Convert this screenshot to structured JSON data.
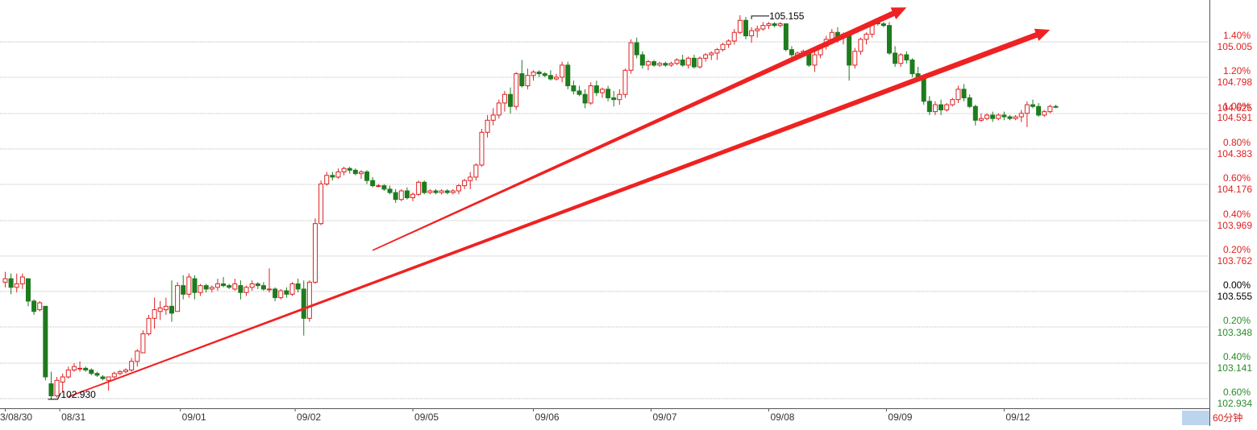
{
  "chart_data": {
    "type": "candlestick",
    "period": "60分钟",
    "colors": {
      "up": "#dd2222",
      "down": "#1e7b1e",
      "grid": "#bbbbbb",
      "axis": "#555555",
      "pct_up": "#dd2222",
      "pct_down": "#2a8c2a",
      "trendline": "#ee2222",
      "period_bg": "#bcd4ee"
    },
    "price_axis": {
      "min": 102.934,
      "max": 105.212,
      "ticks": [
        "105.005",
        "104.798",
        "104.591",
        "104.383",
        "104.176",
        "103.969",
        "103.762",
        "103.555",
        "103.348",
        "103.141",
        "102.934"
      ],
      "last_price": "104.625"
    },
    "pct_axis": {
      "reference_price": 103.555,
      "ticks": [
        "1.40%",
        "1.20%",
        "1.00%",
        "0.80%",
        "0.60%",
        "0.40%",
        "0.20%",
        "0.00%",
        "0.20%",
        "0.40%",
        "0.60%"
      ]
    },
    "dates": [
      "3/08/30",
      "08/31",
      "09/01",
      "09/02",
      "09/05",
      "09/06",
      "09/07",
      "09/08",
      "09/09",
      "09/12"
    ],
    "date_slot_index": [
      0,
      9.5,
      30.5,
      50.5,
      71,
      92,
      112.5,
      133,
      153.5,
      174
    ],
    "annotations": [
      {
        "label": "105.155",
        "price": 105.155,
        "bar_index": 130
      },
      {
        "label": "102.930",
        "price": 102.93,
        "bar_index": 8
      }
    ],
    "trendlines": [
      {
        "from_bar": 11,
        "from_price": 102.945,
        "to_bar": 182,
        "to_price": 105.075
      },
      {
        "from_bar": 64,
        "from_price": 103.795,
        "to_bar": 157,
        "to_price": 105.205
      }
    ],
    "candles": [
      [
        103.61,
        103.67,
        103.58,
        103.63
      ],
      [
        103.63,
        103.66,
        103.54,
        103.58
      ],
      [
        103.58,
        103.66,
        103.55,
        103.6
      ],
      [
        103.6,
        103.66,
        103.57,
        103.64
      ],
      [
        103.63,
        103.63,
        103.47,
        103.5
      ],
      [
        103.5,
        103.51,
        103.42,
        103.44
      ],
      [
        103.45,
        103.5,
        103.44,
        103.49
      ],
      [
        103.47,
        103.47,
        103.04,
        103.06
      ],
      [
        103.02,
        103.09,
        102.93,
        102.95
      ],
      [
        102.95,
        103.06,
        102.94,
        103.04
      ],
      [
        103.03,
        103.08,
        102.97,
        103.06
      ],
      [
        103.06,
        103.12,
        103.05,
        103.1
      ],
      [
        103.1,
        103.14,
        103.09,
        103.12
      ],
      [
        103.11,
        103.15,
        103.09,
        103.11
      ],
      [
        103.11,
        103.12,
        103.09,
        103.1
      ],
      [
        103.1,
        103.11,
        103.07,
        103.08
      ],
      [
        103.08,
        103.09,
        103.06,
        103.07
      ],
      [
        103.06,
        103.07,
        103.04,
        103.05
      ],
      [
        103.04,
        103.05,
        102.98,
        103.06
      ],
      [
        103.06,
        103.09,
        103.05,
        103.08
      ],
      [
        103.08,
        103.1,
        103.07,
        103.09
      ],
      [
        103.09,
        103.11,
        103.08,
        103.1
      ],
      [
        103.1,
        103.17,
        103.09,
        103.15
      ],
      [
        103.15,
        103.22,
        103.12,
        103.21
      ],
      [
        103.2,
        103.33,
        103.2,
        103.31
      ],
      [
        103.31,
        103.42,
        103.3,
        103.4
      ],
      [
        103.4,
        103.52,
        103.34,
        103.45
      ],
      [
        103.44,
        103.5,
        103.39,
        103.46
      ],
      [
        103.45,
        103.52,
        103.42,
        103.47
      ],
      [
        103.47,
        103.62,
        103.38,
        103.43
      ],
      [
        103.44,
        103.61,
        103.44,
        103.59
      ],
      [
        103.59,
        103.65,
        103.51,
        103.54
      ],
      [
        103.54,
        103.66,
        103.52,
        103.64
      ],
      [
        103.63,
        103.65,
        103.51,
        103.55
      ],
      [
        103.55,
        103.6,
        103.53,
        103.59
      ],
      [
        103.59,
        103.6,
        103.55,
        103.57
      ],
      [
        103.57,
        103.59,
        103.55,
        103.58
      ],
      [
        103.58,
        103.63,
        103.56,
        103.6
      ],
      [
        103.6,
        103.64,
        103.58,
        103.59
      ],
      [
        103.59,
        103.6,
        103.57,
        103.58
      ],
      [
        103.57,
        103.63,
        103.56,
        103.6
      ],
      [
        103.59,
        103.62,
        103.51,
        103.55
      ],
      [
        103.55,
        103.59,
        103.53,
        103.58
      ],
      [
        103.58,
        103.62,
        103.56,
        103.6
      ],
      [
        103.6,
        103.61,
        103.57,
        103.59
      ],
      [
        103.59,
        103.61,
        103.56,
        103.57
      ],
      [
        103.57,
        103.69,
        103.55,
        103.57
      ],
      [
        103.57,
        103.58,
        103.5,
        103.52
      ],
      [
        103.52,
        103.57,
        103.51,
        103.56
      ],
      [
        103.56,
        103.58,
        103.52,
        103.54
      ],
      [
        103.54,
        103.61,
        103.53,
        103.6
      ],
      [
        103.6,
        103.63,
        103.55,
        103.57
      ],
      [
        103.57,
        103.62,
        103.3,
        103.4
      ],
      [
        103.4,
        103.62,
        103.38,
        103.61
      ],
      [
        103.61,
        103.98,
        103.6,
        103.95
      ],
      [
        103.95,
        104.2,
        103.94,
        104.18
      ],
      [
        104.18,
        104.25,
        104.17,
        104.23
      ],
      [
        104.23,
        104.25,
        104.2,
        104.22
      ],
      [
        104.22,
        104.27,
        104.21,
        104.25
      ],
      [
        104.25,
        104.28,
        104.23,
        104.27
      ],
      [
        104.27,
        104.28,
        104.24,
        104.26
      ],
      [
        104.26,
        104.27,
        104.23,
        104.24
      ],
      [
        104.24,
        104.26,
        104.21,
        104.25
      ],
      [
        104.25,
        104.26,
        104.18,
        104.2
      ],
      [
        104.2,
        104.22,
        104.16,
        104.17
      ],
      [
        104.17,
        104.18,
        104.16,
        104.17
      ],
      [
        104.17,
        104.18,
        104.14,
        104.15
      ],
      [
        104.15,
        104.17,
        104.12,
        104.13
      ],
      [
        104.13,
        104.15,
        104.07,
        104.09
      ],
      [
        104.09,
        104.15,
        104.08,
        104.14
      ],
      [
        104.14,
        104.16,
        104.09,
        104.1
      ],
      [
        104.1,
        104.13,
        104.08,
        104.12
      ],
      [
        104.12,
        104.2,
        104.11,
        104.19
      ],
      [
        104.19,
        104.2,
        104.12,
        104.13
      ],
      [
        104.13,
        104.15,
        104.12,
        104.14
      ],
      [
        104.14,
        104.15,
        104.12,
        104.13
      ],
      [
        104.13,
        104.15,
        104.12,
        104.14
      ],
      [
        104.14,
        104.15,
        104.12,
        104.13
      ],
      [
        104.13,
        104.15,
        104.12,
        104.14
      ],
      [
        104.14,
        104.18,
        104.12,
        104.17
      ],
      [
        104.17,
        104.21,
        104.15,
        104.2
      ],
      [
        104.2,
        104.25,
        104.15,
        104.22
      ],
      [
        104.22,
        104.3,
        104.2,
        104.29
      ],
      [
        104.29,
        104.5,
        104.28,
        104.48
      ],
      [
        104.48,
        104.58,
        104.45,
        104.55
      ],
      [
        104.55,
        104.62,
        104.52,
        104.58
      ],
      [
        104.58,
        104.67,
        104.56,
        104.65
      ],
      [
        104.65,
        104.72,
        104.6,
        104.7
      ],
      [
        104.7,
        104.74,
        104.59,
        104.63
      ],
      [
        104.63,
        104.83,
        104.61,
        104.82
      ],
      [
        104.82,
        104.9,
        104.74,
        104.75
      ],
      [
        104.75,
        104.85,
        104.73,
        104.81
      ],
      [
        104.81,
        104.84,
        104.78,
        104.83
      ],
      [
        104.83,
        104.84,
        104.8,
        104.82
      ],
      [
        104.82,
        104.83,
        104.8,
        104.81
      ],
      [
        104.81,
        104.84,
        104.78,
        104.79
      ],
      [
        104.79,
        104.82,
        104.78,
        104.8
      ],
      [
        104.8,
        104.89,
        104.77,
        104.87
      ],
      [
        104.87,
        104.89,
        104.73,
        104.75
      ],
      [
        104.75,
        104.78,
        104.7,
        104.72
      ],
      [
        104.72,
        104.75,
        104.69,
        104.7
      ],
      [
        104.7,
        104.73,
        104.62,
        104.65
      ],
      [
        104.65,
        104.77,
        104.64,
        104.75
      ],
      [
        104.75,
        104.78,
        104.69,
        104.71
      ],
      [
        104.71,
        104.74,
        104.68,
        104.73
      ],
      [
        104.73,
        104.75,
        104.66,
        104.68
      ],
      [
        104.68,
        104.72,
        104.63,
        104.67
      ],
      [
        104.67,
        104.73,
        104.64,
        104.7
      ],
      [
        104.7,
        104.85,
        104.68,
        104.84
      ],
      [
        104.84,
        105.02,
        104.82,
        105.0
      ],
      [
        105.0,
        105.03,
        104.91,
        104.93
      ],
      [
        104.93,
        104.95,
        104.85,
        104.87
      ],
      [
        104.87,
        104.9,
        104.84,
        104.89
      ],
      [
        104.89,
        104.9,
        104.86,
        104.87
      ],
      [
        104.87,
        104.89,
        104.86,
        104.88
      ],
      [
        104.88,
        104.89,
        104.86,
        104.87
      ],
      [
        104.87,
        104.89,
        104.86,
        104.88
      ],
      [
        104.88,
        104.91,
        104.87,
        104.9
      ],
      [
        104.9,
        104.93,
        104.86,
        104.87
      ],
      [
        104.87,
        104.92,
        104.85,
        104.91
      ],
      [
        104.91,
        104.93,
        104.85,
        104.86
      ],
      [
        104.86,
        104.92,
        104.85,
        104.91
      ],
      [
        104.91,
        104.94,
        104.89,
        104.93
      ],
      [
        104.93,
        104.95,
        104.9,
        104.94
      ],
      [
        104.94,
        104.97,
        104.9,
        104.96
      ],
      [
        104.96,
        105.0,
        104.95,
        104.99
      ],
      [
        104.99,
        105.02,
        104.97,
        105.01
      ],
      [
        105.01,
        105.08,
        104.99,
        105.06
      ],
      [
        105.06,
        105.16,
        105.05,
        105.13
      ],
      [
        105.13,
        105.15,
        105.02,
        105.04
      ],
      [
        105.04,
        105.09,
        105.0,
        105.07
      ],
      [
        105.07,
        105.1,
        105.03,
        105.08
      ],
      [
        105.08,
        105.12,
        105.07,
        105.1
      ],
      [
        105.1,
        105.12,
        105.08,
        105.11
      ],
      [
        105.11,
        105.12,
        105.09,
        105.1
      ],
      [
        105.1,
        105.12,
        105.09,
        105.11
      ],
      [
        105.11,
        105.11,
        104.95,
        104.96
      ],
      [
        104.96,
        104.98,
        104.91,
        104.93
      ],
      [
        104.93,
        104.95,
        104.9,
        104.94
      ],
      [
        104.94,
        104.96,
        104.92,
        104.95
      ],
      [
        104.95,
        104.96,
        104.86,
        104.87
      ],
      [
        104.87,
        104.95,
        104.83,
        104.93
      ],
      [
        104.93,
        104.99,
        104.91,
        104.98
      ],
      [
        104.98,
        105.04,
        104.96,
        105.02
      ],
      [
        105.02,
        105.08,
        104.99,
        105.06
      ],
      [
        105.06,
        105.09,
        105.0,
        105.03
      ],
      [
        105.03,
        105.06,
        104.99,
        105.05
      ],
      [
        105.05,
        105.07,
        104.78,
        104.87
      ],
      [
        104.87,
        104.97,
        104.85,
        104.95
      ],
      [
        104.95,
        105.03,
        104.93,
        105.02
      ],
      [
        105.02,
        105.06,
        104.99,
        105.05
      ],
      [
        105.05,
        105.13,
        105.03,
        105.12
      ],
      [
        105.12,
        105.13,
        105.1,
        105.11
      ],
      [
        105.11,
        105.12,
        105.09,
        105.1
      ],
      [
        105.1,
        105.12,
        104.93,
        104.94
      ],
      [
        104.94,
        104.98,
        104.86,
        104.88
      ],
      [
        104.88,
        104.94,
        104.86,
        104.93
      ],
      [
        104.93,
        104.95,
        104.88,
        104.9
      ],
      [
        104.9,
        104.91,
        104.8,
        104.82
      ],
      [
        104.82,
        104.86,
        104.78,
        104.8
      ],
      [
        104.8,
        104.81,
        104.64,
        104.66
      ],
      [
        104.66,
        104.69,
        104.58,
        104.6
      ],
      [
        104.6,
        104.66,
        104.58,
        104.64
      ],
      [
        104.64,
        104.67,
        104.58,
        104.61
      ],
      [
        104.61,
        104.65,
        104.6,
        104.64
      ],
      [
        104.64,
        104.68,
        104.63,
        104.67
      ],
      [
        104.67,
        104.75,
        104.65,
        104.73
      ],
      [
        104.73,
        104.76,
        104.66,
        104.68
      ],
      [
        104.68,
        104.7,
        104.62,
        104.63
      ],
      [
        104.63,
        104.64,
        104.52,
        104.55
      ],
      [
        104.55,
        104.59,
        104.54,
        104.56
      ],
      [
        104.56,
        104.59,
        104.55,
        104.58
      ],
      [
        104.58,
        104.6,
        104.54,
        104.56
      ],
      [
        104.56,
        104.59,
        104.55,
        104.58
      ],
      [
        104.58,
        104.6,
        104.55,
        104.57
      ],
      [
        104.57,
        104.58,
        104.55,
        104.56
      ],
      [
        104.56,
        104.58,
        104.55,
        104.57
      ],
      [
        104.57,
        104.61,
        104.54,
        104.59
      ],
      [
        104.59,
        104.66,
        104.51,
        104.64
      ],
      [
        104.64,
        104.67,
        104.62,
        104.63
      ],
      [
        104.63,
        104.65,
        104.57,
        104.58
      ],
      [
        104.58,
        104.61,
        104.57,
        104.6
      ],
      [
        104.6,
        104.64,
        104.59,
        104.63
      ],
      [
        104.63,
        104.64,
        104.62,
        104.625
      ]
    ]
  }
}
